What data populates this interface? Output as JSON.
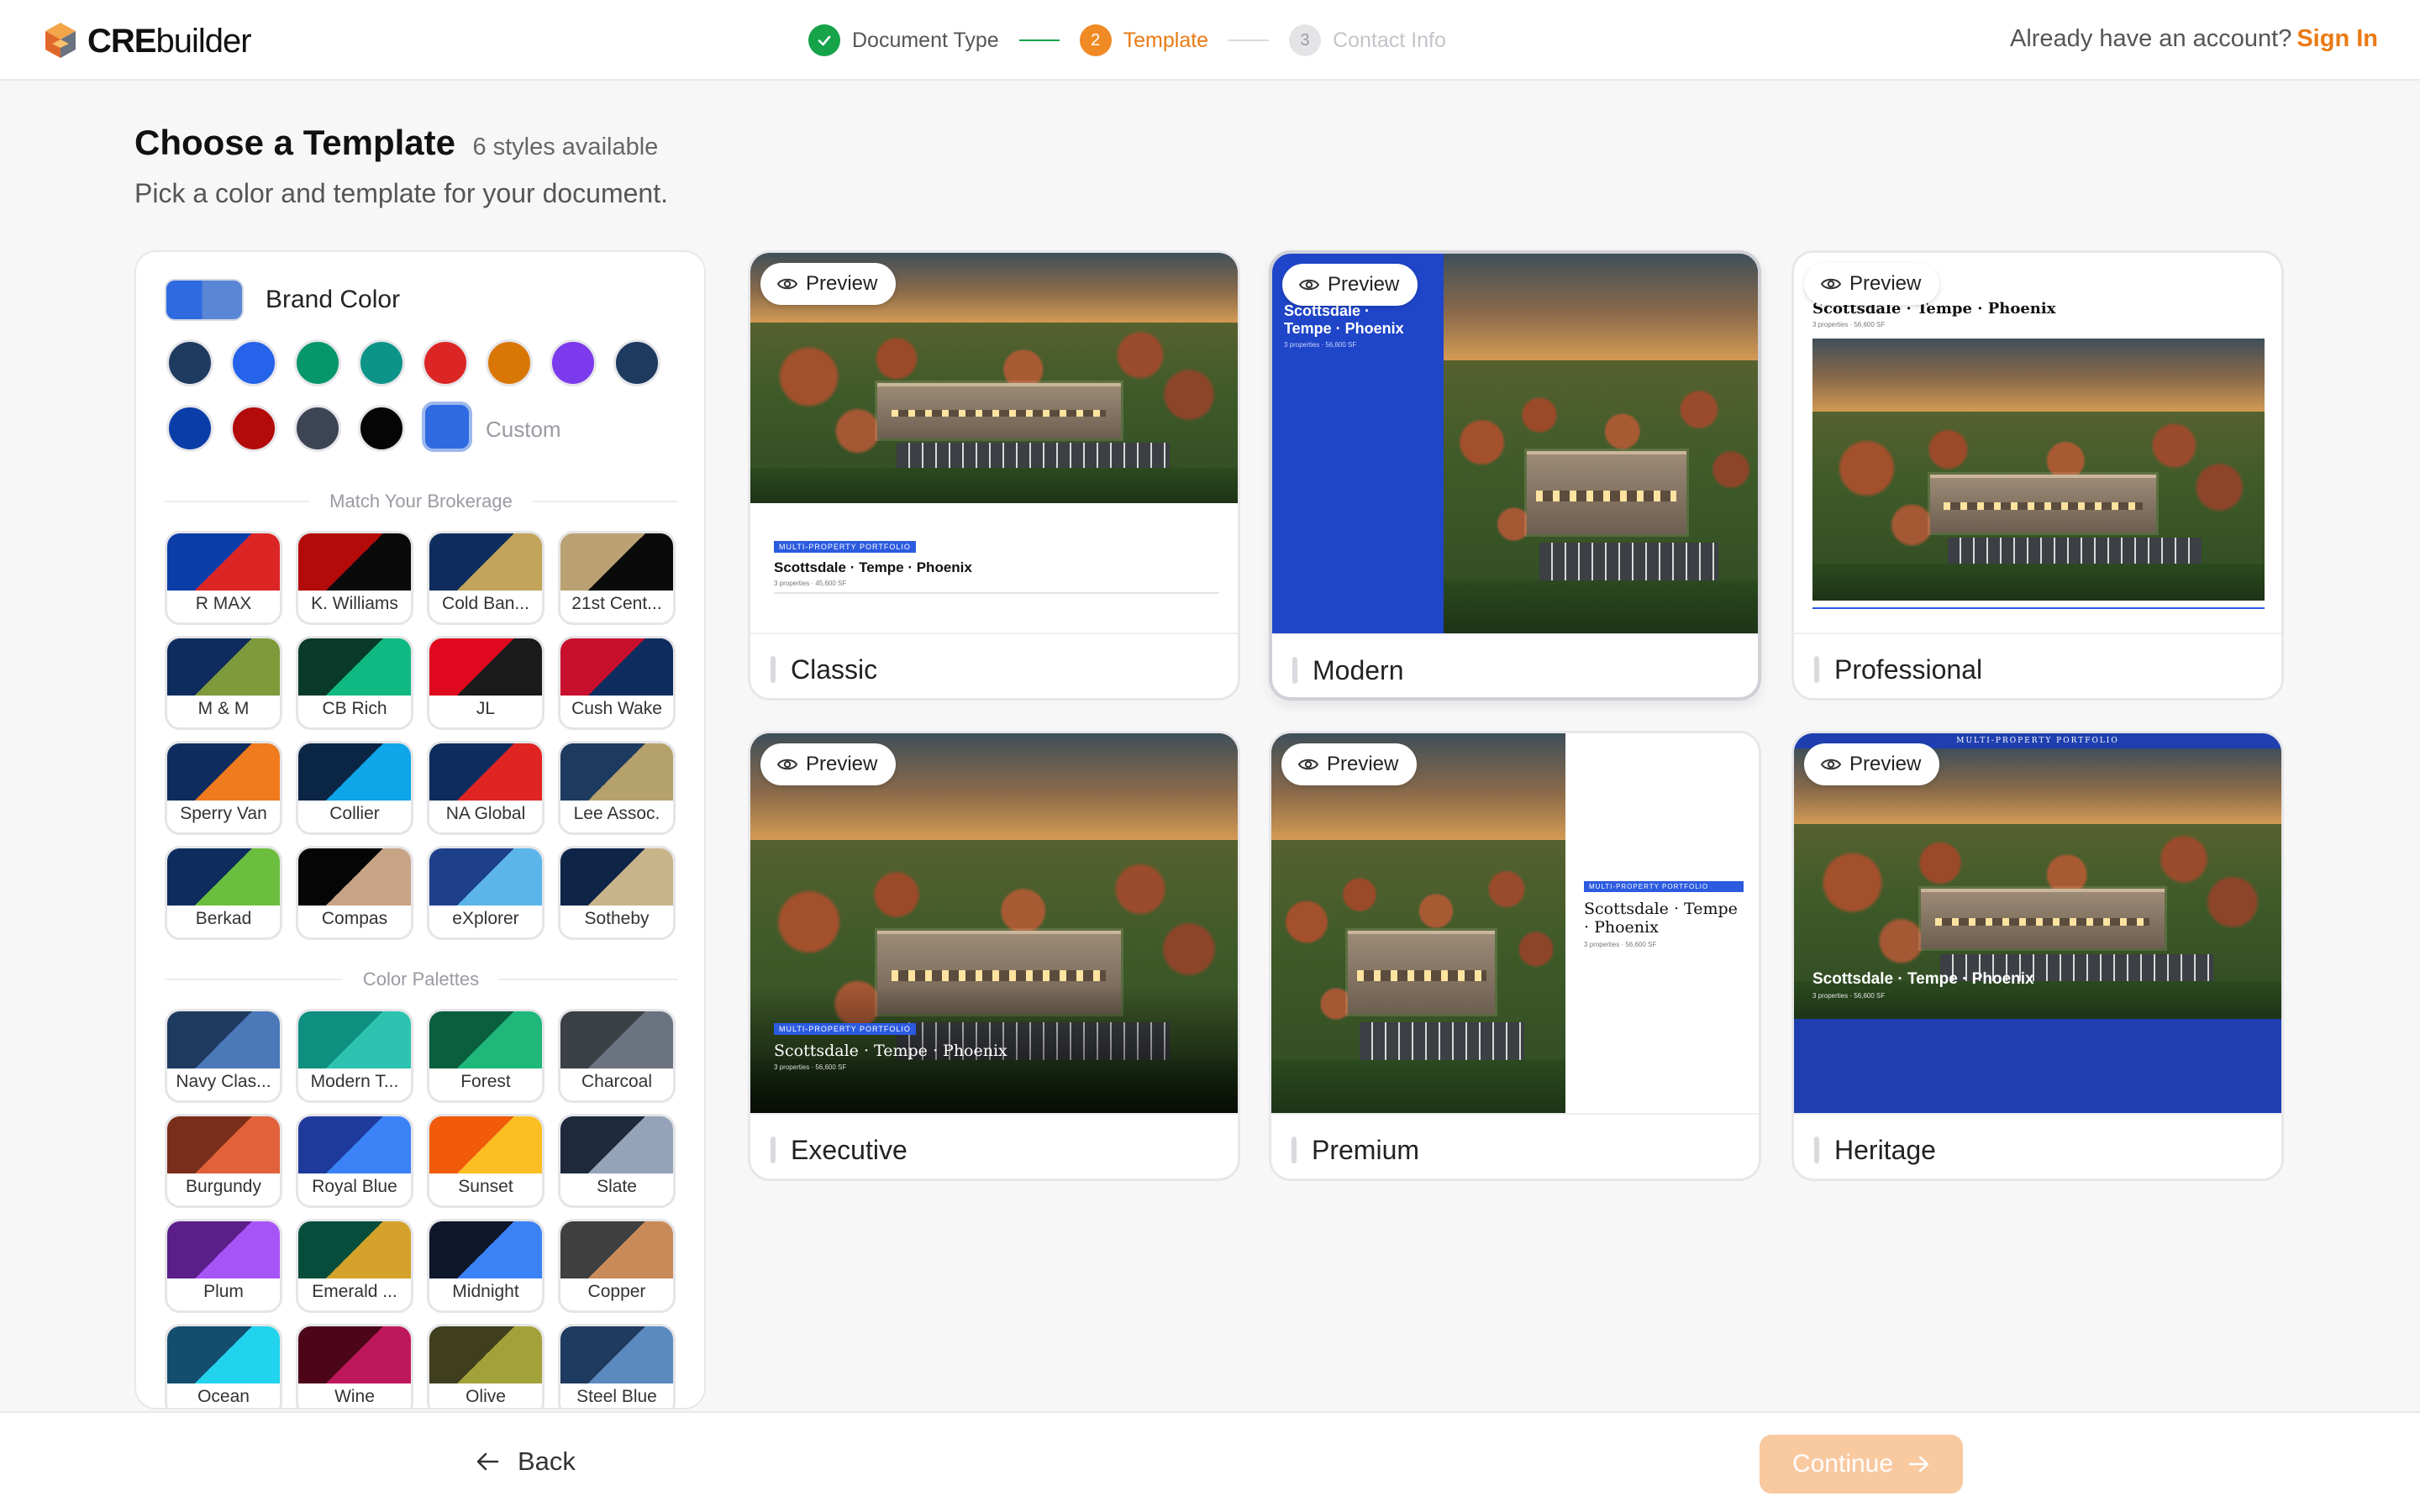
{
  "app": {
    "name_a": "CRE",
    "name_b": "builder"
  },
  "steps": [
    {
      "num": "1",
      "label": "Document Type",
      "state": "done"
    },
    {
      "num": "2",
      "label": "Template",
      "state": "active"
    },
    {
      "num": "3",
      "label": "Contact Info",
      "state": "todo"
    }
  ],
  "account": {
    "prompt": "Already have an account?",
    "signin": "Sign In"
  },
  "header": {
    "title": "Choose a Template",
    "count": "6 styles available",
    "subtitle": "Pick a color and template for your document."
  },
  "sidebar": {
    "brand_color_label": "Brand Color",
    "colors": [
      "#1f3a5f",
      "#2563eb",
      "#059669",
      "#0d9488",
      "#dc2626",
      "#d97706",
      "#7c3aed",
      "#1e3a5f",
      "#0a3da8",
      "#b30a0a",
      "#3d4554",
      "#050505"
    ],
    "custom_color": "#2f6ae0",
    "custom_label": "Custom",
    "brokerage_heading": "Match Your Brokerage",
    "brokerages": [
      {
        "name": "R MAX",
        "c1": "#0a3da8",
        "c2": "#dc2626"
      },
      {
        "name": "K. Williams",
        "c1": "#b30a0a",
        "c2": "#0a0a0a"
      },
      {
        "name": "Cold Ban...",
        "c1": "#0e2d5e",
        "c2": "#c2a45a"
      },
      {
        "name": "21st Cent...",
        "c1": "#b9a171",
        "c2": "#0a0a0a"
      },
      {
        "name": "M & M",
        "c1": "#0e2d5e",
        "c2": "#7e9a3a"
      },
      {
        "name": "CB Rich",
        "c1": "#0a3a2a",
        "c2": "#10b981"
      },
      {
        "name": "JL",
        "c1": "#e0081e",
        "c2": "#1a1a1a"
      },
      {
        "name": "Cush Wake",
        "c1": "#c8102e",
        "c2": "#0e2d5e"
      },
      {
        "name": "Sperry Van",
        "c1": "#0e2d5e",
        "c2": "#f07a1e"
      },
      {
        "name": "Collier",
        "c1": "#0b2545",
        "c2": "#0ea5e9"
      },
      {
        "name": "NA Global",
        "c1": "#0e2d5e",
        "c2": "#e02424"
      },
      {
        "name": "Lee Assoc.",
        "c1": "#1e3a5f",
        "c2": "#b5a16c"
      },
      {
        "name": "Berkad",
        "c1": "#0e2d5e",
        "c2": "#6cbf3e"
      },
      {
        "name": "Compas",
        "c1": "#050505",
        "c2": "#c8a486"
      },
      {
        "name": "eXplorer",
        "c1": "#1e3f8a",
        "c2": "#5bb4ea"
      },
      {
        "name": "Sotheby",
        "c1": "#0e2548",
        "c2": "#c9b48a"
      }
    ],
    "palettes_heading": "Color Palettes",
    "palettes": [
      {
        "name": "Navy Clas...",
        "c1": "#1e3a5f",
        "c2": "#4a78b8"
      },
      {
        "name": "Modern T...",
        "c1": "#0f8f80",
        "c2": "#2cc4b0"
      },
      {
        "name": "Forest",
        "c1": "#0b5e3e",
        "c2": "#1fb87a"
      },
      {
        "name": "Charcoal",
        "c1": "#3b3f46",
        "c2": "#6b7280"
      },
      {
        "name": "Burgundy",
        "c1": "#7a2e1a",
        "c2": "#e0613a"
      },
      {
        "name": "Royal Blue",
        "c1": "#1e3a9a",
        "c2": "#3b82f6"
      },
      {
        "name": "Sunset",
        "c1": "#f05a0a",
        "c2": "#fbbf24"
      },
      {
        "name": "Slate",
        "c1": "#1e293b",
        "c2": "#94a3b8"
      },
      {
        "name": "Plum",
        "c1": "#5b1f8a",
        "c2": "#a855f7"
      },
      {
        "name": "Emerald ...",
        "c1": "#064e3b",
        "c2": "#d4a22a"
      },
      {
        "name": "Midnight",
        "c1": "#0f172a",
        "c2": "#3b82f6"
      },
      {
        "name": "Copper",
        "c1": "#3f3f3f",
        "c2": "#c98a5a"
      },
      {
        "name": "Ocean",
        "c1": "#134e6f",
        "c2": "#22d3ee"
      },
      {
        "name": "Wine",
        "c1": "#4c0519",
        "c2": "#be185d"
      },
      {
        "name": "Olive",
        "c1": "#3f3f1f",
        "c2": "#a3a23a"
      },
      {
        "name": "Steel Blue",
        "c1": "#1e3a5f",
        "c2": "#5b8abf"
      }
    ]
  },
  "templates": [
    {
      "id": "classic",
      "name": "Classic",
      "selected": false
    },
    {
      "id": "modern",
      "name": "Modern",
      "selected": true
    },
    {
      "id": "professional",
      "name": "Professional",
      "selected": false
    },
    {
      "id": "executive",
      "name": "Executive",
      "selected": false
    },
    {
      "id": "premium",
      "name": "Premium",
      "selected": false
    },
    {
      "id": "heritage",
      "name": "Heritage",
      "selected": false
    }
  ],
  "preview_label": "Preview",
  "sample_doc": {
    "tag": "MULTI-PROPERTY PORTFOLIO",
    "title": "Scottsdale · Tempe · Phoenix",
    "title_short_1": "Scottsdale ·",
    "title_short_2": "Tempe · Phoenix",
    "stats": "3 properties · 56,600 SF",
    "stats_alt": "3 properties · 45,600 SF"
  },
  "footer": {
    "back": "Back",
    "continue": "Continue"
  },
  "theme": {
    "accent": "#ea7a14",
    "accent_light": "#f9c9a0",
    "success": "#16a34a",
    "doc_blue": "#2c5be0",
    "heritage_blue": "#1f3fb0"
  }
}
